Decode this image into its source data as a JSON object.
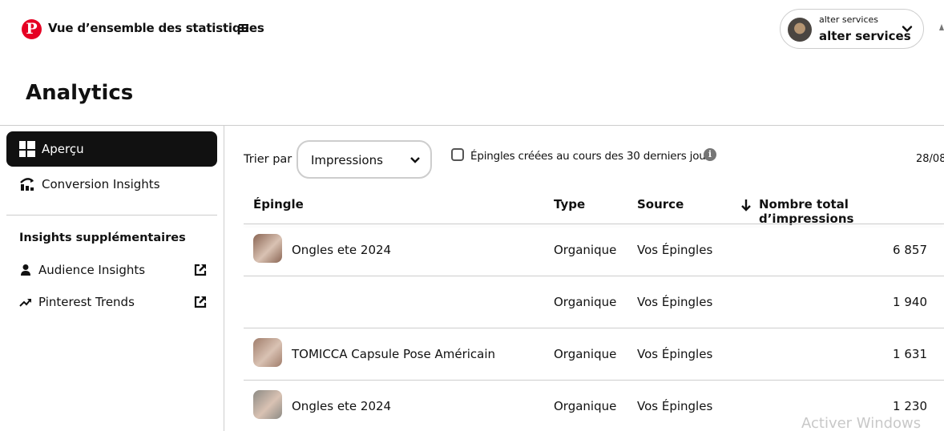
{
  "header": {
    "logo_glyph": "P",
    "title": "Vue d’ensemble des statistiques",
    "menu_icon": "hamburger-icon",
    "account": {
      "business_name": "alter services",
      "display_name": "alter services"
    }
  },
  "page": {
    "title": "Analytics"
  },
  "sidebar": {
    "items": [
      {
        "label": "Aperçu",
        "icon": "dashboard-grid-icon",
        "active": true
      },
      {
        "label": "Conversion Insights",
        "icon": "conversion-chart-icon",
        "active": false
      }
    ],
    "section_heading": "Insights supplémentaires",
    "external_items": [
      {
        "label": "Audience Insights",
        "icon": "audience-person-icon"
      },
      {
        "label": "Pinterest Trends",
        "icon": "trend-arrow-icon"
      }
    ]
  },
  "filters": {
    "sort_label": "Trier par",
    "sort_value": "Impressions",
    "checkbox_label": "Épingles créées au cours des 30 derniers jours",
    "checkbox_checked": false,
    "date": "28/08"
  },
  "table": {
    "columns": {
      "pin": "Épingle",
      "type": "Type",
      "source": "Source",
      "impressions": "Nombre total d’impressions"
    },
    "sort_direction": "descending",
    "rows": [
      {
        "title": "Ongles ete 2024",
        "type": "Organique",
        "source": "Vos Épingles",
        "impressions": "6 857",
        "thumb_color": "#8a6553"
      },
      {
        "title": "",
        "type": "Organique",
        "source": "Vos Épingles",
        "impressions": "1 940",
        "thumb_color": "#ffffff"
      },
      {
        "title": "TOMICCA Capsule Pose Américain",
        "type": "Organique",
        "source": "Vos Épingles",
        "impressions": "1 631",
        "thumb_color": "#a07d6b"
      },
      {
        "title": "Ongles ete 2024",
        "type": "Organique",
        "source": "Vos Épingles",
        "impressions": "1 230",
        "thumb_color": "#8c8a84"
      }
    ]
  },
  "watermark": "Activer Windows"
}
